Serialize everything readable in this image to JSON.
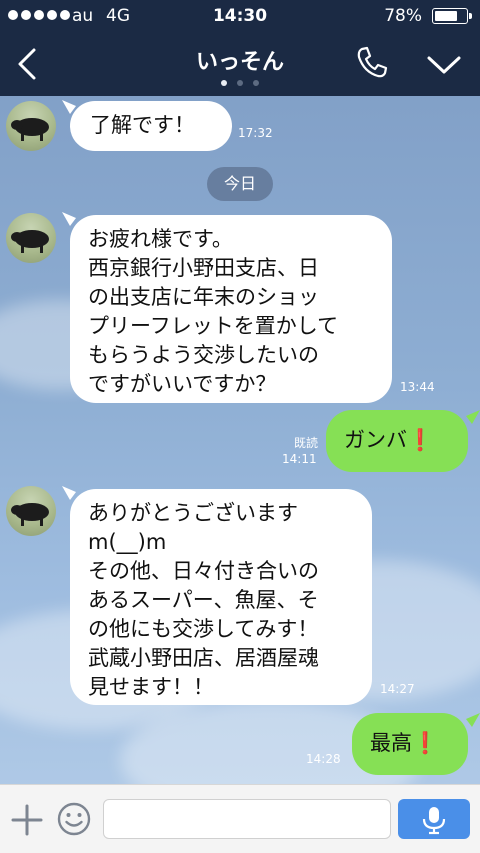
{
  "status_bar": {
    "carrier": "au",
    "network": "4G",
    "time": "14:30",
    "battery_text": "78%",
    "battery_level": 0.78
  },
  "header": {
    "title": "いっそん",
    "page_dots": 3,
    "active_dot": 0
  },
  "date_separator": "今日",
  "messages": [
    {
      "side": "left",
      "lines": [
        "了解です！"
      ],
      "time": "17:32"
    },
    {
      "side": "left",
      "lines": [
        "お疲れ様です。",
        "西京銀行小野田支店、日",
        "の出支店に年末のショッ",
        "プリーフレットを置かして",
        "もらうよう交渉したいの",
        "ですがいいですか？"
      ],
      "time": "13:44"
    },
    {
      "side": "right",
      "text": "ガンバ",
      "emoji": "❗",
      "read": "既読",
      "time": "14:11"
    },
    {
      "side": "left",
      "lines": [
        "ありがとうございます",
        "m(__)m",
        "その他、日々付き合いの",
        "あるスーパー、魚屋、そ",
        "の他にも交渉してみす！",
        "武蔵小野田店、居酒屋魂",
        "見せます！！"
      ],
      "time": "14:27"
    },
    {
      "side": "right",
      "text": "最高",
      "emoji": "❗",
      "time": "14:28"
    }
  ],
  "colors": {
    "header": "#1b2a44",
    "bubble_left": "#ffffff",
    "bubble_right": "#86e055",
    "send_button": "#4a8fe8"
  },
  "icons": {
    "back": "chevron-left-icon",
    "call": "phone-icon",
    "menu": "chevron-down-icon",
    "add": "plus-icon",
    "sticker": "smiley-icon",
    "voice": "microphone-icon"
  }
}
